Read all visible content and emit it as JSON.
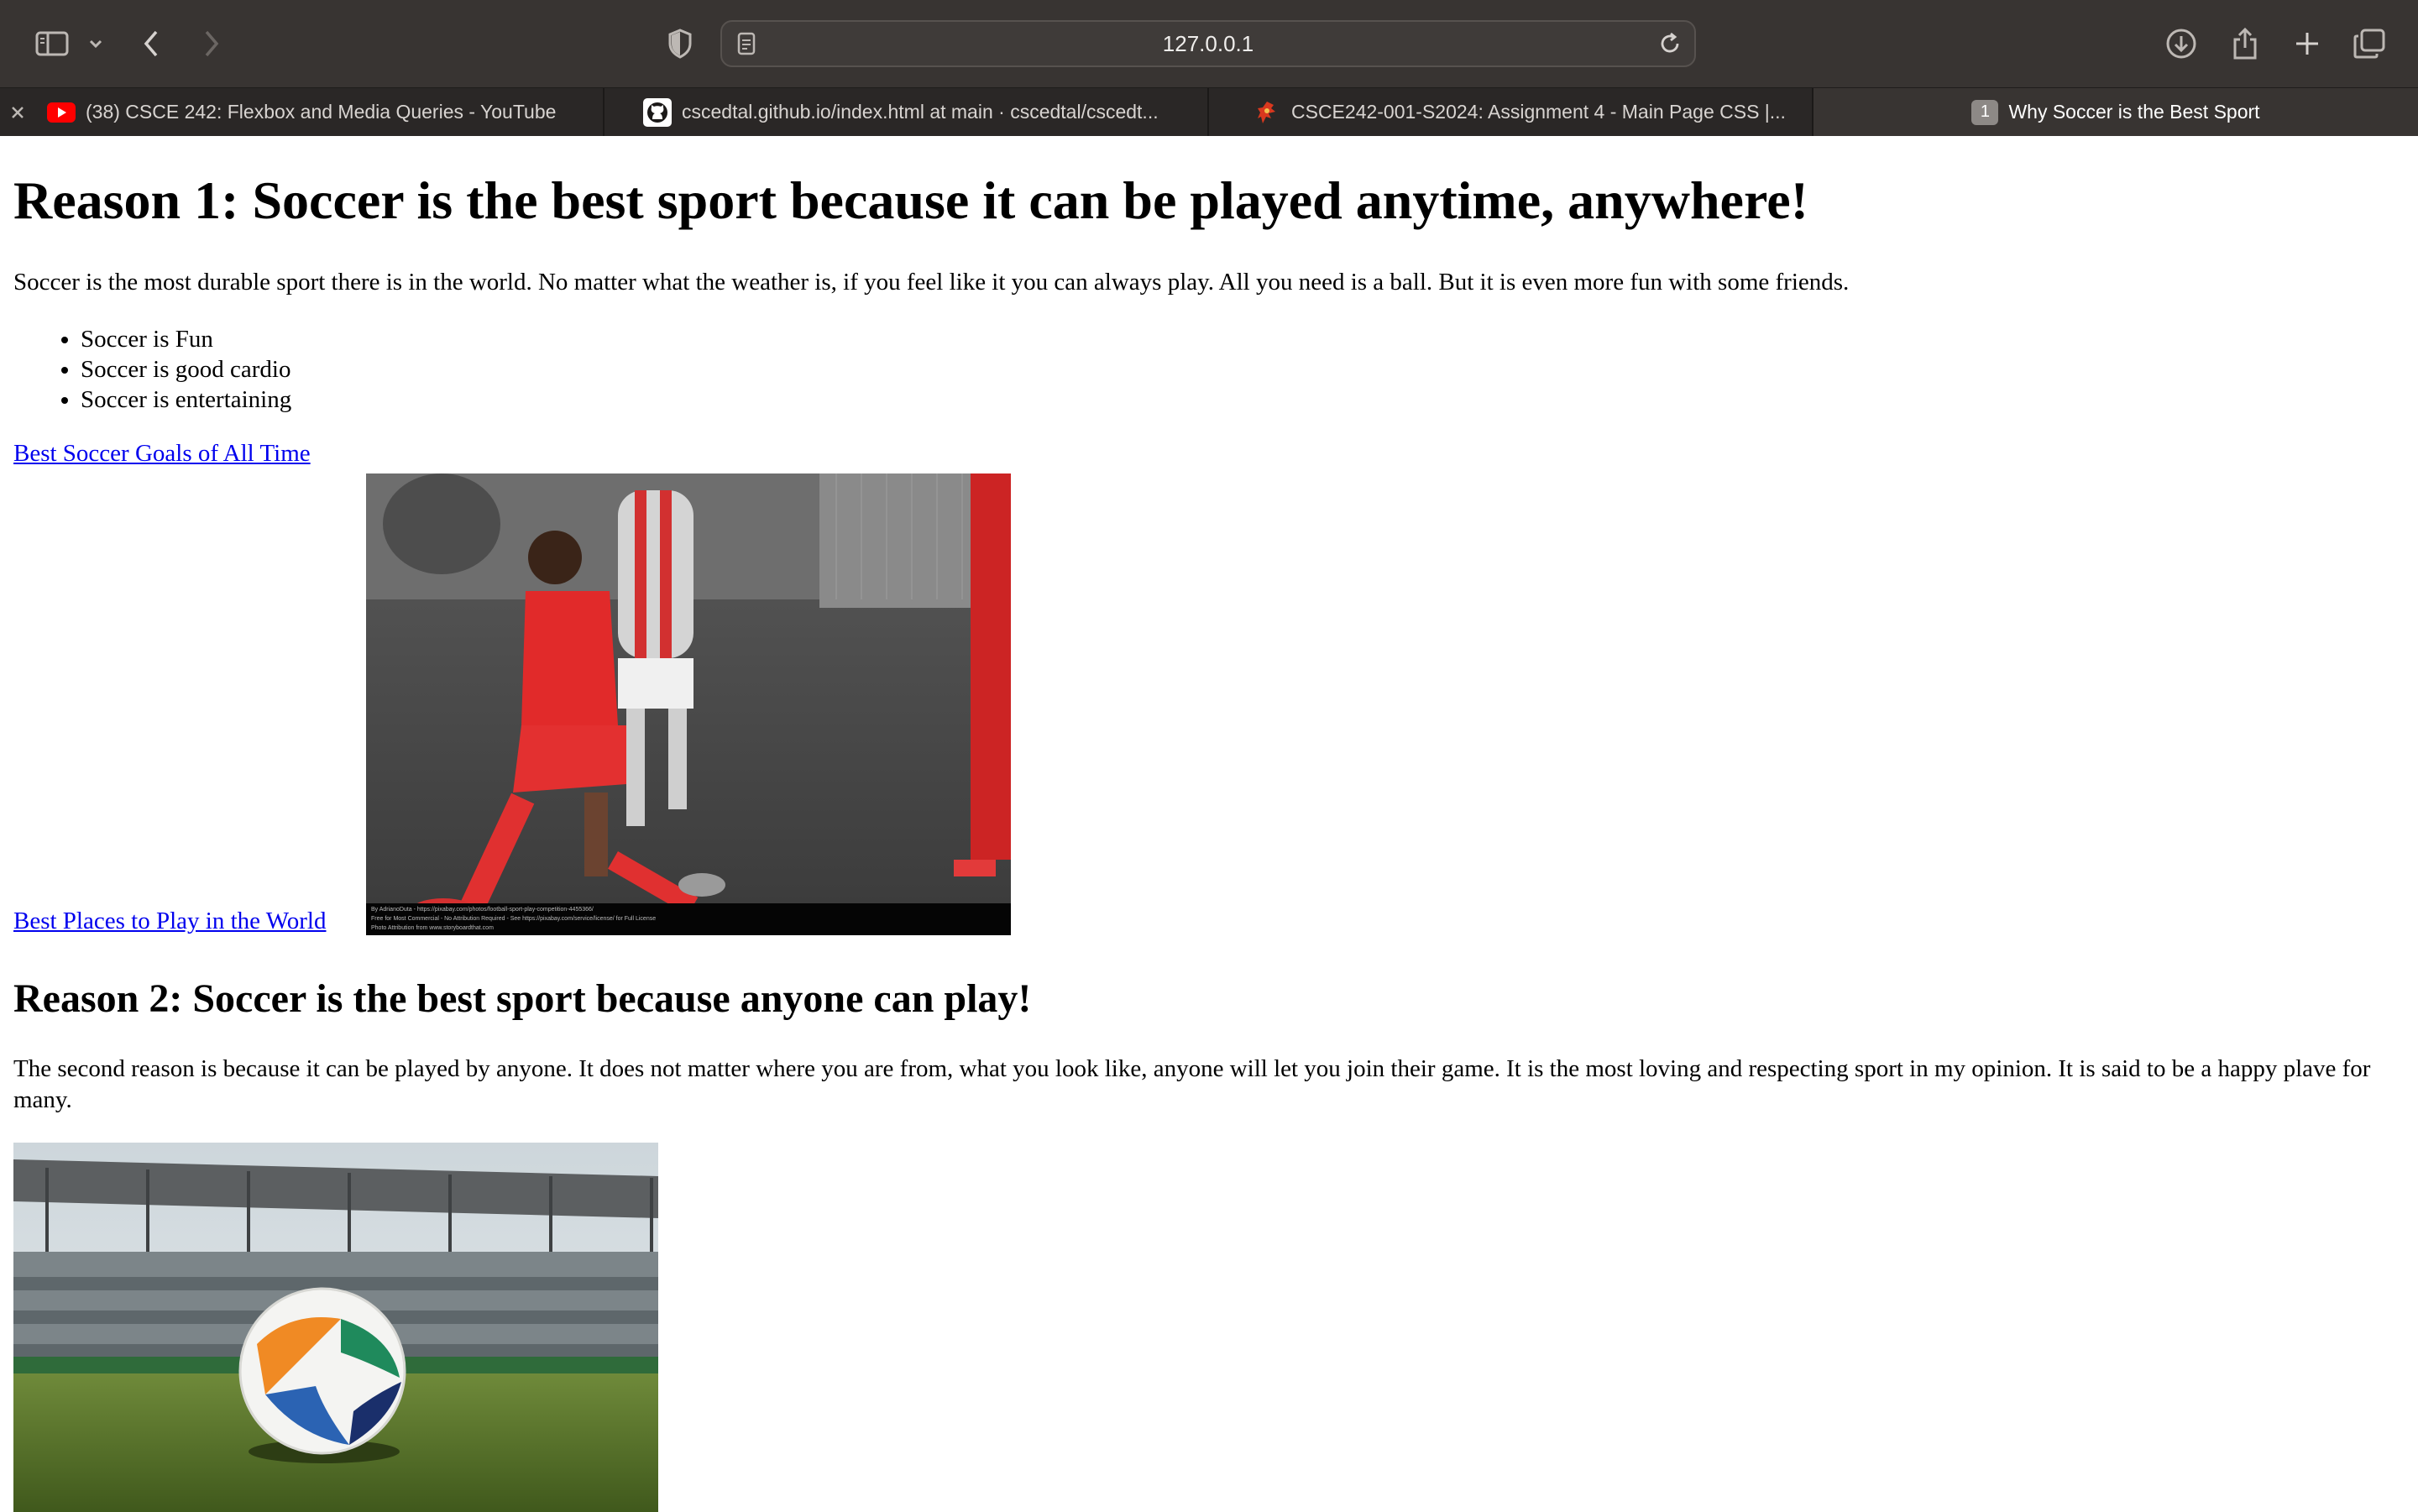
{
  "browser": {
    "url": "127.0.0.1",
    "tabs": [
      {
        "label": "(38) CSCE 242: Flexbox and Media Queries - YouTube",
        "icon": "youtube-icon",
        "active": false
      },
      {
        "label": "cscedtal.github.io/index.html at main · cscedtal/cscedt...",
        "icon": "github-icon",
        "active": false
      },
      {
        "label": "CSCE242-001-S2024: Assignment 4 - Main Page CSS |...",
        "icon": "course-icon",
        "active": false
      },
      {
        "label": "Why Soccer is the Best Sport",
        "icon": "tab-number-badge",
        "badge": "1",
        "active": true
      }
    ],
    "colors": {
      "toolbar": "#383432",
      "tabbar": "#2a2726",
      "accent_youtube": "#ff0000"
    }
  },
  "page": {
    "heading1": "Reason 1: Soccer is the best sport because it can be played anytime, anywhere!",
    "paragraph1": "Soccer is the most durable sport there is in the world. No matter what the weather is, if you feel like it you can always play. All you need is a ball. But it is even more fun with some friends.",
    "list": [
      "Soccer is Fun",
      "Soccer is good cardio",
      "Soccer is entertaining"
    ],
    "link1": "Best Soccer Goals of All Time",
    "link2": "Best Places to Play in the World",
    "image1_caption": [
      "By AdrianoDuta - https://pixabay.com/photos/football-sport-play-competition-4455366/",
      "Free for Most Commercial - No Attribution Required - See https://pixabay.com/service/license/ for Full License",
      "Photo Attribution from www.storyboardthat.com"
    ],
    "heading2": "Reason 2: Soccer is the best sport because anyone can play!",
    "paragraph2": "The second reason is because it can be played by anyone. It does not matter where you are from, what you look like, anyone will let you join their game. It is the most loving and respecting sport in my opinion. It is said to be a happy plave for many.",
    "link_color": "#0000ee"
  }
}
